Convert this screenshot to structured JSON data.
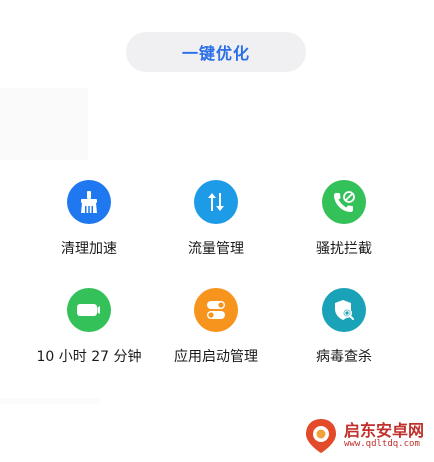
{
  "optimize_button": {
    "label": "一键优化"
  },
  "tools": [
    {
      "label": "清理加速",
      "icon": "broom-icon",
      "color": "#1f78f0"
    },
    {
      "label": "流量管理",
      "icon": "data-arrows-icon",
      "color": "#1e9be6"
    },
    {
      "label": "骚扰拦截",
      "icon": "blocked-call-icon",
      "color": "#34c15a"
    },
    {
      "label": "10 小时 27 分钟",
      "icon": "battery-icon",
      "color": "#34c15a"
    },
    {
      "label": "应用启动管理",
      "icon": "toggle-icon",
      "color": "#f7941d"
    },
    {
      "label": "病毒查杀",
      "icon": "shield-scan-icon",
      "color": "#1aa3b8"
    }
  ],
  "watermark": {
    "name": "启东安卓网",
    "url": "www.qdltdq.com"
  },
  "colors": {
    "accent": "#2a6ee8",
    "button_bg": "#f0f0f2",
    "watermark": "#c0302c"
  }
}
